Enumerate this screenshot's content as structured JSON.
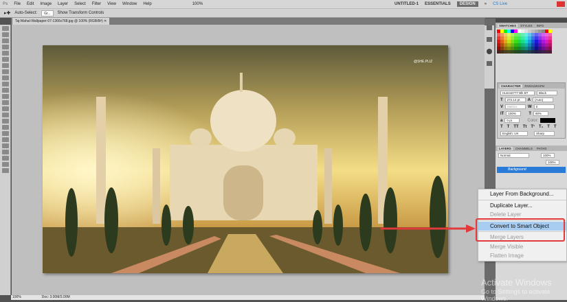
{
  "menu": {
    "logo": "Ps",
    "items": [
      "File",
      "Edit",
      "Image",
      "Layer",
      "Select",
      "Filter",
      "View",
      "Window",
      "Help"
    ],
    "zoom": "100%",
    "workspaces": [
      "UNTITLED-1",
      "ESSENTIALS",
      "DESIGN"
    ],
    "more": "»",
    "cslive": "CS Live"
  },
  "options": {
    "auto_select_label": "Auto-Select:",
    "auto_select_value": "Gr...",
    "show_transform": "Show Transform Controls"
  },
  "document": {
    "tab_title": "Taj-Mahal-Wallpaper-07-1366x768.jpg @ 100% (RGB/8#)",
    "watermark": "@SHE.PLIZ"
  },
  "status": {
    "zoom": "100%",
    "doc": "Doc: 3.00M/3.00M"
  },
  "panels": {
    "swatch_tabs": [
      "SWATCHES",
      "STYLES",
      "INFO"
    ],
    "char_tabs": [
      "CHARACTER",
      "PARAGRAPH"
    ],
    "character": {
      "font": "Humnst777 Blk BT",
      "style": "Black",
      "size": "272.14 pt",
      "leading": "(Auto)",
      "kerning": "Metrics",
      "tracking": "0",
      "vscale": "100%",
      "hscale": "90%",
      "baseline": "0 pt",
      "color_label": "Color:",
      "language": "English: UK",
      "aa": "Sharp"
    },
    "layer_tabs": [
      "LAYERS",
      "CHANNELS",
      "PATHS"
    ],
    "blend": "Normal",
    "opacity": "100%",
    "fill": "100%",
    "layer_name": "Background"
  },
  "context_menu": {
    "items": [
      {
        "label": "Layer From Background...",
        "disabled": false
      },
      {
        "label": "Duplicate Layer...",
        "disabled": false
      },
      {
        "label": "Delete Layer",
        "disabled": true
      },
      {
        "label": "Convert to Smart Object",
        "disabled": false,
        "highlighted": true
      },
      {
        "label": "Merge Layers",
        "disabled": true
      },
      {
        "label": "Merge Visible",
        "disabled": true
      },
      {
        "label": "Flatten Image",
        "disabled": true
      }
    ]
  },
  "os_watermark": {
    "line1": "Activate Windows",
    "line2": "Go to Settings to activate Windows."
  },
  "colors": {
    "highlight": "#a8cdf0",
    "annotation": "#e23a3a"
  }
}
